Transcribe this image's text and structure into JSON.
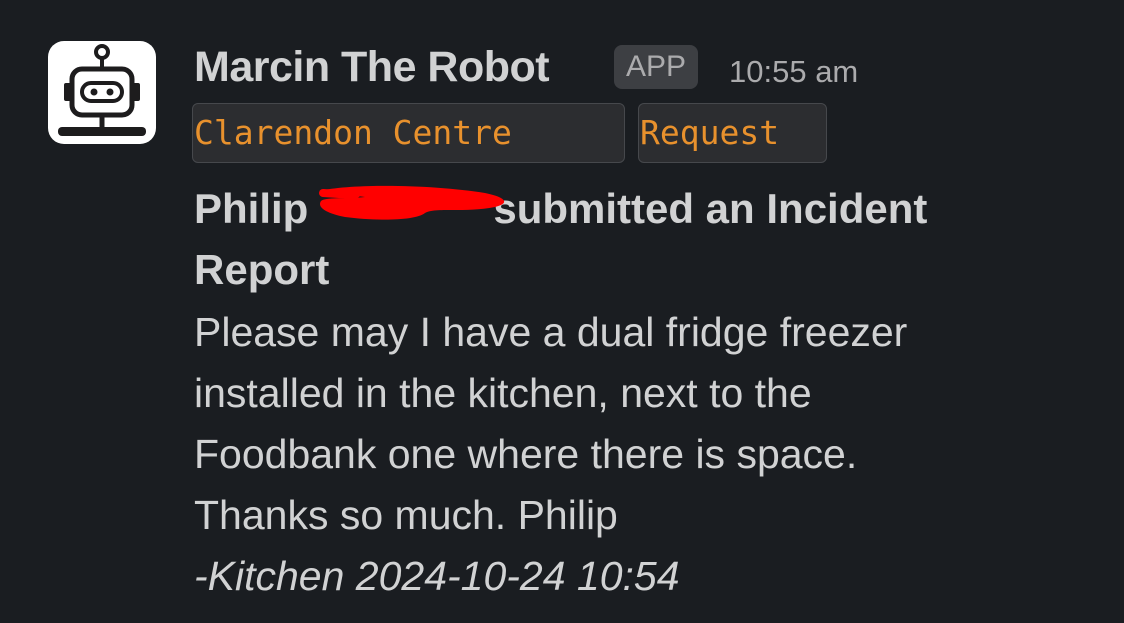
{
  "message": {
    "sender": "Marcin The Robot",
    "badge": "APP",
    "time": "10:55 am",
    "tags": [
      "Clarendon Centre",
      "Request"
    ],
    "title_start": "Philip",
    "title_end": "submitted an Incident Report",
    "body_lines": [
      "Please may I have a dual fridge freezer",
      "installed in the kitchen, next to the",
      "Foodbank one where there is space.",
      "Thanks so much. Philip"
    ],
    "footer": "-Kitchen 2024-10-24 10:54"
  },
  "colors": {
    "background": "#1a1d21",
    "text": "#d1d2d3",
    "muted": "#ababad",
    "code_text": "#e8912d",
    "redaction": "#ff0000"
  },
  "icons": {
    "avatar": "robot-icon"
  }
}
